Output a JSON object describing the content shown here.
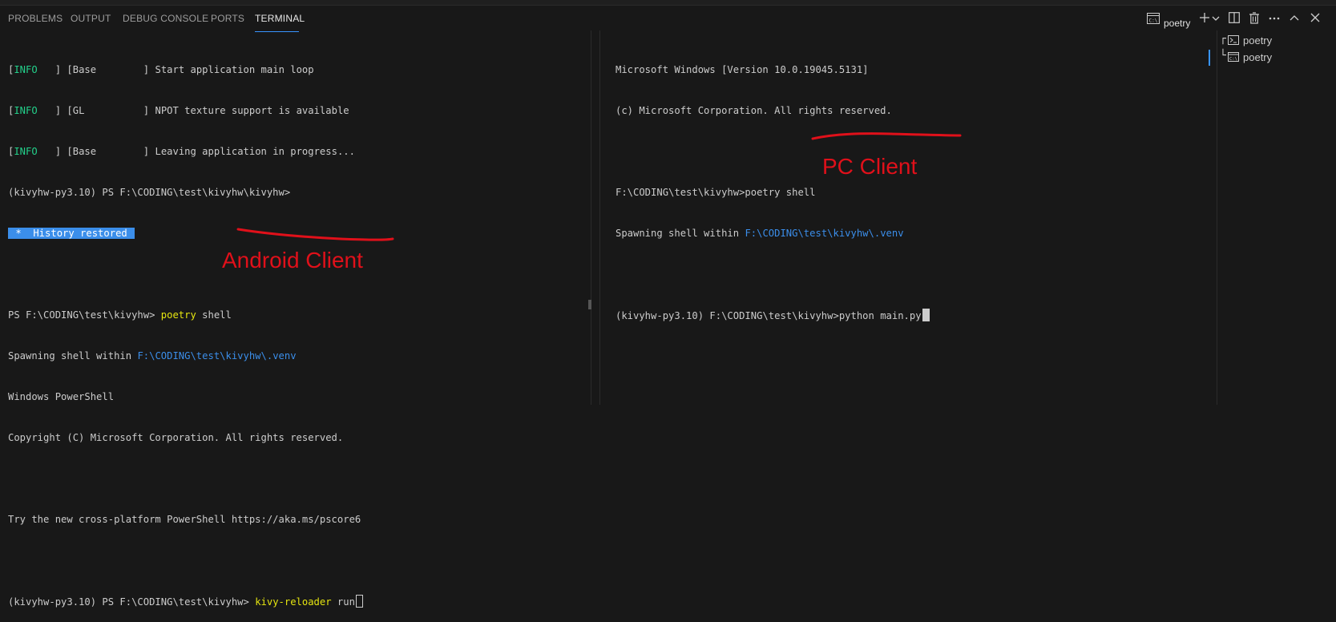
{
  "panel": {
    "tabs": [
      {
        "label": "PROBLEMS"
      },
      {
        "label": "OUTPUT"
      },
      {
        "label": "DEBUG CONSOLE"
      },
      {
        "label": "PORTS"
      },
      {
        "label": "TERMINAL"
      }
    ],
    "active_tab": "TERMINAL",
    "terminal_name": "poetry",
    "accent_color": "#3794ff"
  },
  "left_terminal": {
    "log": [
      {
        "level": "INFO",
        "pad": "   ",
        "module": "[Base        ]",
        "message": "Start application main loop"
      },
      {
        "level": "INFO",
        "pad": "   ",
        "module": "[GL          ]",
        "message": "NPOT texture support is available"
      },
      {
        "level": "INFO",
        "pad": "   ",
        "module": "[Base        ]",
        "message": "Leaving application in progress..."
      }
    ],
    "prompt_old": "(kivyhw-py3.10) PS F:\\CODING\\test\\kivyhw\\kivyhw>",
    "history_restored": " *  History restored ",
    "prompt_ps": "PS F:\\CODING\\test\\kivyhw>",
    "cmd1_keyword": "poetry",
    "cmd1_arg": "shell",
    "spawning_prefix": "Spawning shell within ",
    "venv_path": "F:\\CODING\\test\\kivyhw\\.venv",
    "ps_title": "Windows PowerShell",
    "ps_copyright": "Copyright (C) Microsoft Corporation. All rights reserved.",
    "ps_try": "Try the new cross-platform PowerShell https://aka.ms/pscore6",
    "prompt_final": "(kivyhw-py3.10) PS F:\\CODING\\test\\kivyhw>",
    "cmd2_keyword": "kivy-reloader",
    "cmd2_arg": "run",
    "annotation": "Android Client"
  },
  "right_terminal": {
    "win_version": "Microsoft Windows [Version 10.0.19045.5131]",
    "win_copyright": "(c) Microsoft Corporation. All rights reserved.",
    "cmd_prompt": "F:\\CODING\\test\\kivyhw>poetry shell",
    "spawning_prefix": "Spawning shell within ",
    "venv_path": "F:\\CODING\\test\\kivyhw\\.venv",
    "prompt_final": "(kivyhw-py3.10) F:\\CODING\\test\\kivyhw>",
    "command": "python main.py",
    "annotation": "PC Client"
  },
  "terminal_list": [
    {
      "label": "poetry",
      "icon": "powershell-icon"
    },
    {
      "label": "poetry",
      "icon": "cmd-icon"
    }
  ]
}
